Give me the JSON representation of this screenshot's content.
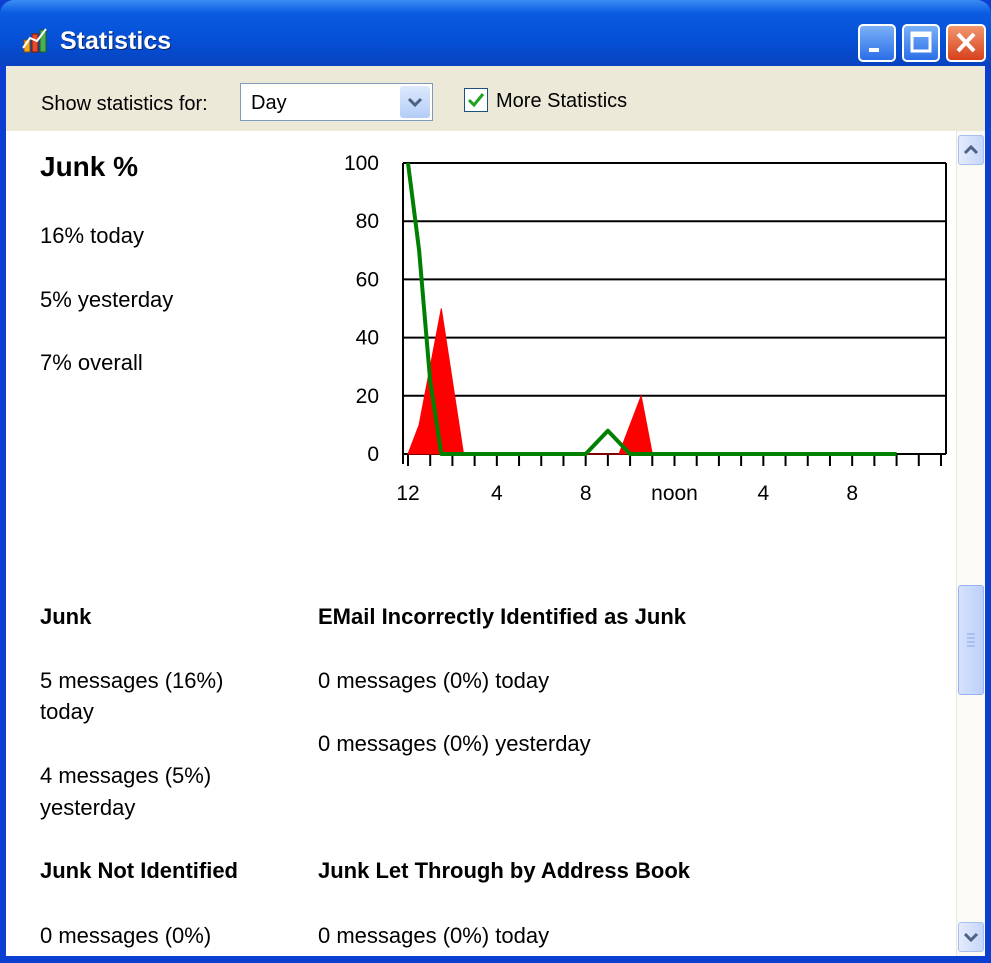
{
  "window": {
    "title": "Statistics",
    "title_icon": "statistics-chart-icon",
    "buttons": [
      "minimize-icon",
      "maximize-icon",
      "close-icon"
    ]
  },
  "toolbar": {
    "show_label": "Show statistics for:",
    "period": "Day",
    "more_statistics_label": "More Statistics",
    "more_statistics_checked": true
  },
  "junk_percent": {
    "heading": "Junk %",
    "today": "16% today",
    "yesterday": "5% yesterday",
    "overall": "7% overall"
  },
  "chart_data": {
    "type": "area",
    "x_tick_labels": [
      "12",
      "4",
      "8",
      "noon",
      "4",
      "8"
    ],
    "y_tick_labels": [
      "100",
      "80",
      "60",
      "40",
      "20",
      "0"
    ],
    "ylim": [
      0,
      100
    ],
    "xlim": [
      0,
      24
    ],
    "grid": true,
    "series": [
      {
        "color": "#ff0000",
        "style": "filled",
        "x": [
          0,
          0.5,
          1,
          1.5,
          2,
          2.5,
          3,
          3.5,
          4,
          8,
          8.5,
          9,
          9.5,
          10,
          10.5,
          11,
          22
        ],
        "y": [
          0,
          10,
          30,
          50,
          25,
          0,
          0,
          0,
          0,
          0,
          0,
          0,
          0,
          10,
          20,
          0,
          0
        ]
      },
      {
        "color": "#008000",
        "style": "line",
        "x": [
          0,
          0.5,
          1,
          1.5,
          2,
          8,
          8.5,
          9,
          9.5,
          10,
          10.5,
          22
        ],
        "y": [
          100,
          70,
          25,
          0,
          0,
          0,
          4,
          8,
          4,
          0,
          0,
          0
        ]
      }
    ]
  },
  "sections": {
    "junk": {
      "heading": "Junk",
      "today_line1": "5 messages (16%)",
      "today_line2": "today",
      "yesterday_line1": "4 messages (5%)",
      "yesterday_line2": "yesterday"
    },
    "incorrect": {
      "heading": "EMail Incorrectly Identified as Junk",
      "today": "0 messages (0%) today",
      "yesterday": "0 messages (0%) yesterday"
    },
    "not_identified": {
      "heading": "Junk Not Identified",
      "today_line1": "0 messages (0%)"
    },
    "address_book": {
      "heading": "Junk Let Through by Address Book",
      "today": "0 messages (0%) today"
    }
  },
  "colors": {
    "title_bar": "#0550d6",
    "window_frame": "#0a3fd1",
    "toolbar_bg": "#ece9d8",
    "junk_series": "#ff0000",
    "total_series": "#008000"
  }
}
